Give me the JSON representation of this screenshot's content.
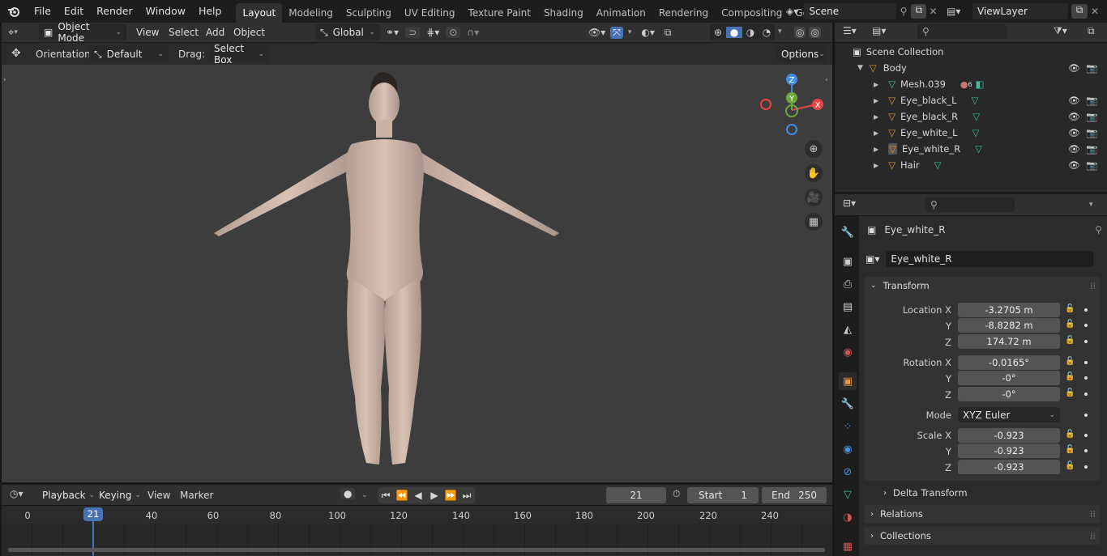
{
  "topbar": {
    "menus": [
      "File",
      "Edit",
      "Render",
      "Window",
      "Help"
    ],
    "workspaces": [
      "Layout",
      "Modeling",
      "Sculpting",
      "UV Editing",
      "Texture Paint",
      "Shading",
      "Animation",
      "Rendering",
      "Compositing",
      "Geometry Noc"
    ],
    "active_workspace": "Layout",
    "scene": "Scene",
    "view_layer": "ViewLayer"
  },
  "viewport_header": {
    "mode": "Object Mode",
    "menus": [
      "View",
      "Select",
      "Add",
      "Object"
    ],
    "transform_orientation": "Global"
  },
  "tool_settings": {
    "orientation_label": "Orientation:",
    "orientation_value": "Default",
    "drag_label": "Drag:",
    "drag_value": "Select Box",
    "options_label": "Options"
  },
  "gizmo": {
    "z": "Z",
    "y": "Y",
    "x": "X"
  },
  "outliner": {
    "root": "Scene Collection",
    "collection": "Body",
    "items": [
      {
        "name": "Mesh.039",
        "badge": "6"
      },
      {
        "name": "Eye_black_L"
      },
      {
        "name": "Eye_black_R"
      },
      {
        "name": "Eye_white_L"
      },
      {
        "name": "Eye_white_R"
      },
      {
        "name": "Hair"
      }
    ]
  },
  "properties": {
    "object_name": "Eye_white_R",
    "datablock_name": "Eye_white_R",
    "transform_title": "Transform",
    "location": {
      "label": "Location X",
      "x": "-3.2705 m",
      "y": "-8.8282 m",
      "z": "174.72 m"
    },
    "rotation": {
      "label": "Rotation X",
      "x": "-0.0165°",
      "y": "-0°",
      "z": "-0°"
    },
    "mode_label": "Mode",
    "mode_value": "XYZ Euler",
    "scale": {
      "label": "Scale X",
      "x": "-0.923",
      "y": "-0.923",
      "z": "-0.923"
    },
    "axis_y": "Y",
    "axis_z": "Z",
    "delta_transform": "Delta Transform",
    "relations": "Relations",
    "collections": "Collections"
  },
  "timeline": {
    "menus": [
      "Playback",
      "Keying",
      "View",
      "Marker"
    ],
    "current_frame": "21",
    "start_label": "Start",
    "start_value": "1",
    "end_label": "End",
    "end_value": "250",
    "ticks": [
      "0",
      "21",
      "40",
      "60",
      "80",
      "100",
      "120",
      "140",
      "160",
      "180",
      "200",
      "220",
      "240"
    ]
  },
  "colors": {
    "accent_blue": "#4772b3",
    "gizmo_x": "#e64545",
    "gizmo_y": "#6ba83b",
    "gizmo_z": "#3e8ee4",
    "object_orange": "#e7933b",
    "mesh_green": "#3dbfa0"
  }
}
